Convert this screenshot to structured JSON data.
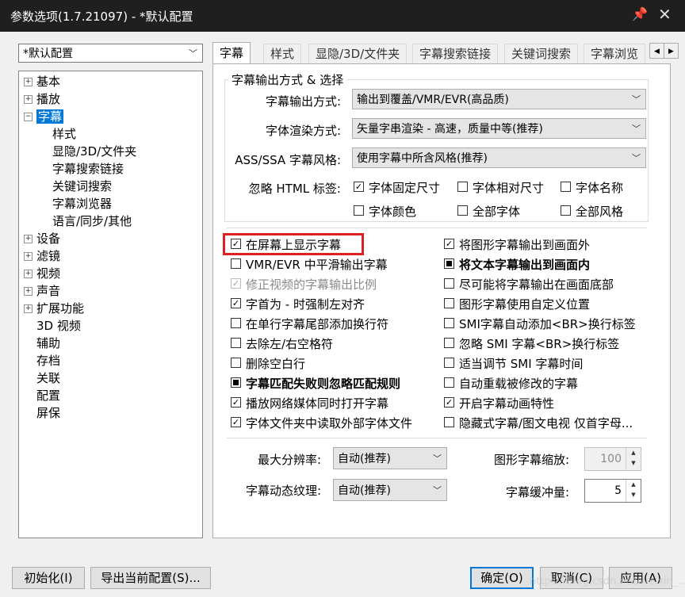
{
  "window": {
    "title": "参数选项(1.7.21097) - *默认配置"
  },
  "profile_select": {
    "value": "*默认配置"
  },
  "tree": [
    {
      "label": "基本"
    },
    {
      "label": "播放"
    },
    {
      "label": "字幕"
    },
    {
      "label": "样式"
    },
    {
      "label": "显隐/3D/文件夹"
    },
    {
      "label": "字幕搜索链接"
    },
    {
      "label": "关键词搜索"
    },
    {
      "label": "字幕浏览器"
    },
    {
      "label": "语言/同步/其他"
    },
    {
      "label": "设备"
    },
    {
      "label": "滤镜"
    },
    {
      "label": "视频"
    },
    {
      "label": "声音"
    },
    {
      "label": "扩展功能"
    },
    {
      "label": "3D 视频"
    },
    {
      "label": "辅助"
    },
    {
      "label": "存档"
    },
    {
      "label": "关联"
    },
    {
      "label": "配置"
    },
    {
      "label": "屏保"
    }
  ],
  "tabs": [
    "字幕",
    "样式",
    "显隐/3D/文件夹",
    "字幕搜索链接",
    "关键词搜索",
    "字幕浏览"
  ],
  "group": {
    "title": "字幕输出方式 & 选择",
    "output_mode": {
      "label": "字幕输出方式:",
      "value": "输出到覆盖/VMR/EVR(高品质)"
    },
    "font_render": {
      "label": "字体渲染方式:",
      "value": "矢量字串渲染 - 高速，质量中等(推荐)"
    },
    "ass_style": {
      "label": "ASS/SSA 字幕风格:",
      "value": "使用字幕中所含风格(推荐)"
    },
    "ignore_html": {
      "label": "忽略 HTML 标签:"
    },
    "html_opts": [
      {
        "label": "字体固定尺寸",
        "state": "checked"
      },
      {
        "label": "字体相对尺寸",
        "state": "unchecked"
      },
      {
        "label": "字体名称",
        "state": "unchecked"
      },
      {
        "label": "字体颜色",
        "state": "unchecked"
      },
      {
        "label": "全部字体",
        "state": "unchecked"
      },
      {
        "label": "全部风格",
        "state": "unchecked"
      }
    ]
  },
  "left_opts": [
    {
      "label": "在屏幕上显示字幕",
      "state": "checked"
    },
    {
      "label": "VMR/EVR 中平滑输出字幕",
      "state": "unchecked"
    },
    {
      "label": "修正视频的字幕输出比例",
      "state": "disabled"
    },
    {
      "label": "字首为 - 时强制左对齐",
      "state": "checked"
    },
    {
      "label": "在单行字幕尾部添加换行符",
      "state": "unchecked"
    },
    {
      "label": "去除左/右空格符",
      "state": "unchecked"
    },
    {
      "label": "删除空白行",
      "state": "unchecked"
    },
    {
      "label": "字幕匹配失败则忽略匹配规则",
      "state": "partial"
    },
    {
      "label": "播放网络媒体同时打开字幕",
      "state": "checked"
    },
    {
      "label": "字体文件夹中读取外部字体文件",
      "state": "checked"
    }
  ],
  "right_opts": [
    {
      "label": "将图形字幕输出到画面外",
      "state": "checked"
    },
    {
      "label": "将文本字幕输出到画面内",
      "state": "partial"
    },
    {
      "label": "尽可能将字幕输出在画面底部",
      "state": "unchecked"
    },
    {
      "label": "图形字幕使用自定义位置",
      "state": "unchecked"
    },
    {
      "label": "SMI字幕自动添加<BR>换行标签",
      "state": "unchecked"
    },
    {
      "label": "忽略 SMI 字幕<BR>换行标签",
      "state": "unchecked"
    },
    {
      "label": "适当调节 SMI 字幕时间",
      "state": "unchecked"
    },
    {
      "label": "自动重载被修改的字幕",
      "state": "unchecked"
    },
    {
      "label": "开启字幕动画特性",
      "state": "checked"
    },
    {
      "label": "隐藏式字幕/图文电视 仅首字母...",
      "state": "unchecked"
    }
  ],
  "bottom": {
    "max_res": {
      "label": "最大分辨率:",
      "value": "自动(推荐)"
    },
    "texture": {
      "label": "字幕动态纹理:",
      "value": "自动(推荐)"
    },
    "scale": {
      "label": "图形字幕缩放:",
      "value": "100"
    },
    "buffer": {
      "label": "字幕缓冲量:",
      "value": "5"
    }
  },
  "buttons": {
    "init": "初始化(I)",
    "export": "导出当前配置(S)...",
    "ok": "确定(O)",
    "cancel": "取消(C)",
    "apply": "应用(A)"
  },
  "watermark": "https://blog.csdn.net/weixin_..."
}
